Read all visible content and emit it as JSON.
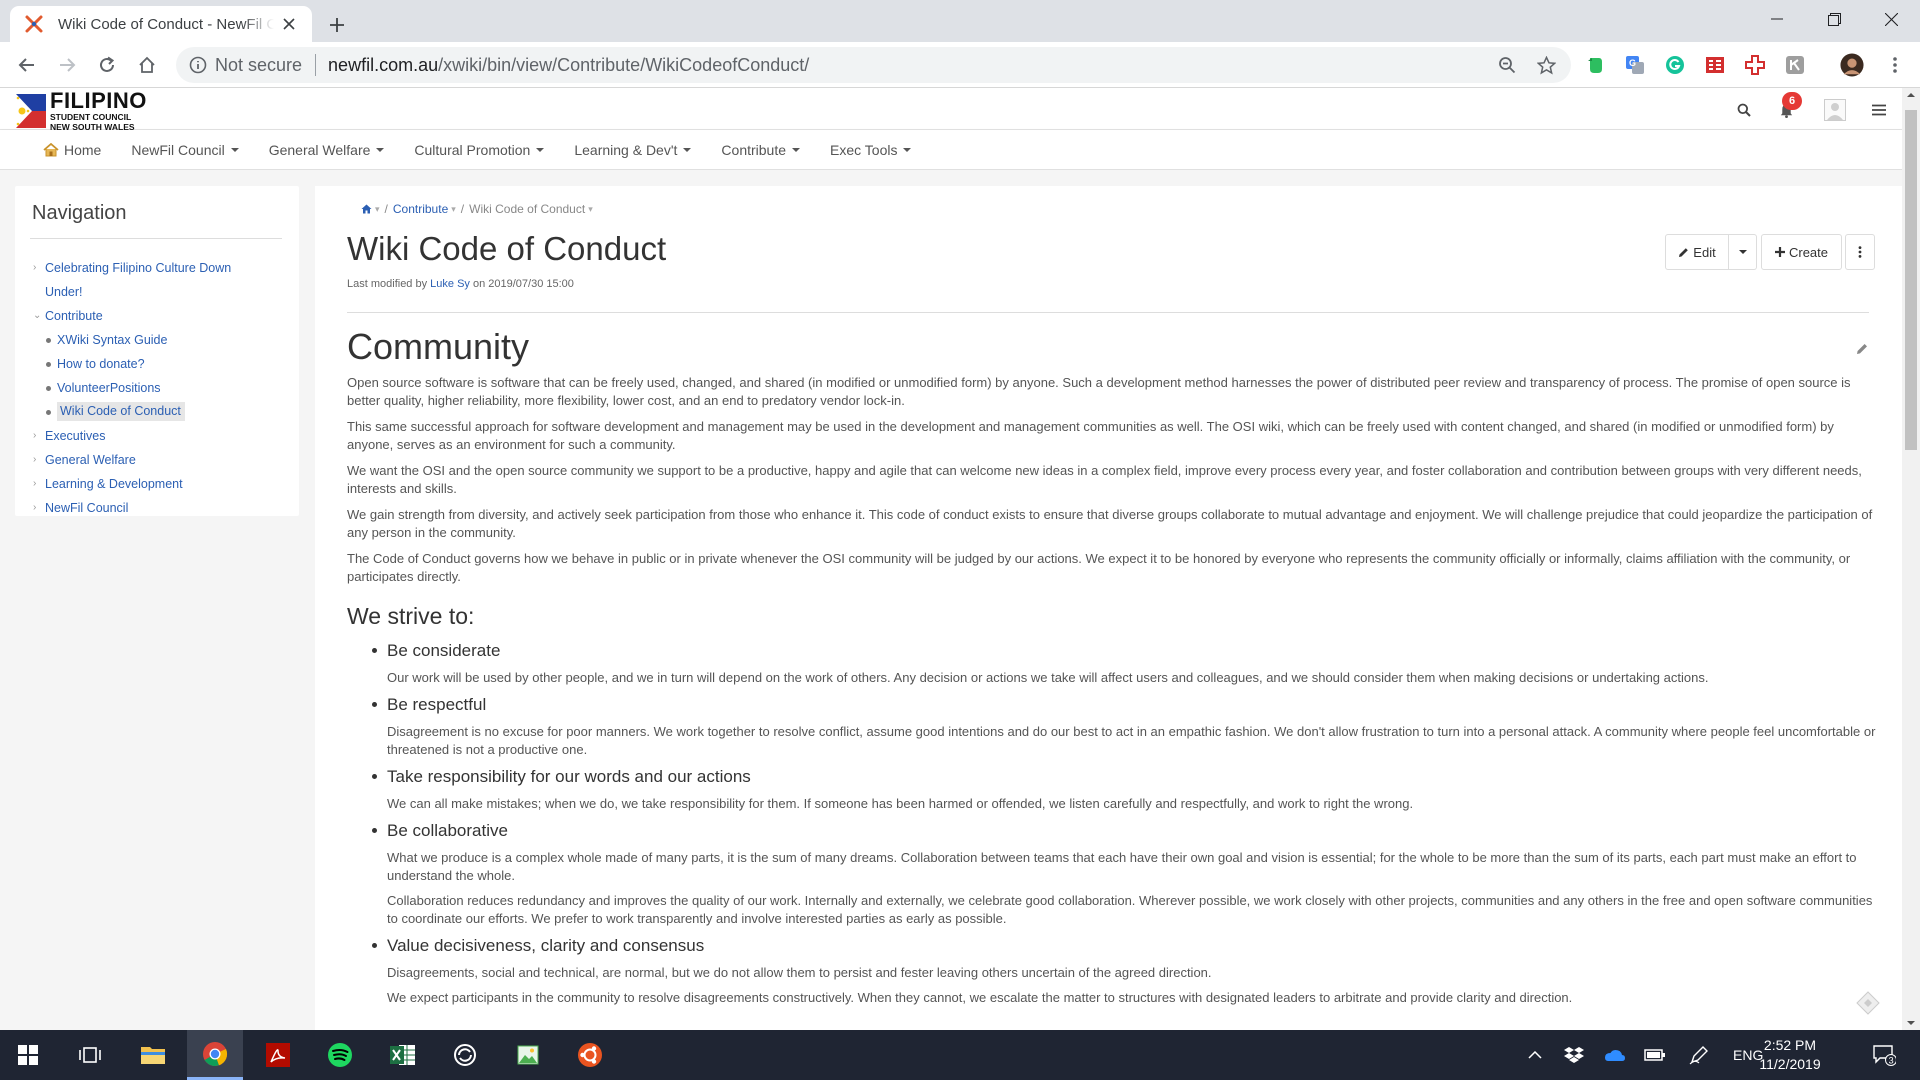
{
  "browser": {
    "tab_title": "Wiki Code of Conduct - NewFil C",
    "security": "Not secure",
    "url_host": "newfil.com.au",
    "url_path": "/xwiki/bin/view/Contribute/WikiCodeofConduct/"
  },
  "site": {
    "logo_main": "FILIPINO",
    "logo_sub1": "STUDENT COUNCIL",
    "logo_sub2": "NEW SOUTH WALES",
    "notification_count": "6",
    "menu": [
      {
        "label": "Home",
        "dropdown": false
      },
      {
        "label": "NewFil Council",
        "dropdown": true
      },
      {
        "label": "General Welfare",
        "dropdown": true
      },
      {
        "label": "Cultural Promotion",
        "dropdown": true
      },
      {
        "label": "Learning & Dev't",
        "dropdown": true
      },
      {
        "label": "Contribute",
        "dropdown": true
      },
      {
        "label": "Exec Tools",
        "dropdown": true
      }
    ]
  },
  "navigation": {
    "title": "Navigation",
    "items": [
      {
        "label": "Celebrating Filipino Culture Down",
        "label2": "Under!",
        "arrow": "›"
      },
      {
        "label": "Contribute",
        "arrow": "⌄"
      },
      {
        "label": "XWiki Syntax Guide"
      },
      {
        "label": "How to donate?"
      },
      {
        "label": "VolunteerPositions"
      },
      {
        "label": "Wiki Code of Conduct"
      },
      {
        "label": "Executives",
        "arrow": "›"
      },
      {
        "label": "General Welfare",
        "arrow": "›"
      },
      {
        "label": "Learning & Development",
        "arrow": "›"
      },
      {
        "label": "NewFil Council",
        "arrow": "›"
      }
    ]
  },
  "page": {
    "breadcrumb": [
      "Contribute",
      "Wiki Code of Conduct"
    ],
    "title": "Wiki Code of Conduct",
    "last_modified_prefix": "Last modified by",
    "author": "Luke Sy",
    "last_modified_suffix": "on 2019/07/30 15:00",
    "edit_label": "Edit",
    "create_label": "Create",
    "heading": "Community",
    "paragraphs": [
      "Open source software is software that can be freely used, changed, and shared (in modified or unmodified form) by anyone. Such a development method harnesses the power of distributed peer review and transparency of process. The promise of open source is better quality, higher reliability, more flexibility, lower cost, and an end to predatory vendor lock-in.",
      "This same successful approach for software development and management may be used in the development and management communities as well. The OSI wiki, which can be freely used with content changed, and shared (in modified or unmodified form) by anyone, serves as an environment for such a community.",
      "We want the OSI and the open source community we support to be a productive, happy and agile that can welcome new ideas in a complex field, improve every process every year, and foster collaboration and contribution between groups with very different needs, interests and skills.",
      "We gain strength from diversity, and actively seek participation from those who enhance it. This code of conduct exists to ensure that diverse groups collaborate to mutual advantage and enjoyment. We will challenge prejudice that could jeopardize the participation of any person in the community.",
      "The Code of Conduct governs how we behave in public or in private whenever the OSI community will be judged by our actions. We expect it to be honored by everyone who represents the community officially or informally, claims affiliation with the community, or participates directly."
    ],
    "subheading": "We strive to:",
    "strive": [
      {
        "title": "Be considerate",
        "paras": [
          "Our work will be used by other people, and we in turn will depend on the work of others. Any decision or actions we take will affect users and colleagues, and we should consider them when making decisions or undertaking actions."
        ]
      },
      {
        "title": "Be respectful",
        "paras": [
          "Disagreement is no excuse for poor manners. We work together to resolve conflict, assume good intentions and do our best to act in an empathic fashion. We don't allow frustration to turn into a personal attack. A community where people feel uncomfortable or threatened is not a productive one."
        ]
      },
      {
        "title": "Take responsibility for our words and our actions",
        "paras": [
          "We can all make mistakes; when we do, we take responsibility for them. If someone has been harmed or offended, we listen carefully and respectfully, and work to right the wrong."
        ]
      },
      {
        "title": "Be collaborative",
        "paras": [
          "What we produce is a complex whole made of many parts, it is the sum of many dreams. Collaboration between teams that each have their own goal and vision is essential; for the whole to be more than the sum of its parts, each part must make an effort to understand the whole.",
          "Collaboration reduces redundancy and improves the quality of our work. Internally and externally, we celebrate good collaboration. Wherever possible, we work closely with other projects, communities and any others in the free and open software communities to coordinate our efforts. We prefer to work transparently and involve interested parties as early as possible."
        ]
      },
      {
        "title": "Value decisiveness, clarity and consensus",
        "paras": [
          "Disagreements, social and technical, are normal, but we do not allow them to persist and fester leaving others uncertain of the agreed direction.",
          "We expect participants in the community to resolve disagreements constructively. When they cannot, we escalate the matter to structures with designated leaders to arbitrate and provide clarity and direction."
        ]
      }
    ]
  },
  "taskbar": {
    "time": "2:52 PM",
    "date": "11/2/2019",
    "language": "ENG",
    "notifications": "3"
  },
  "colors": {
    "link": "#2b5fb3",
    "badge": "#e53935",
    "taskbar": "#1f2533",
    "tabstrip": "#dee1e6"
  }
}
